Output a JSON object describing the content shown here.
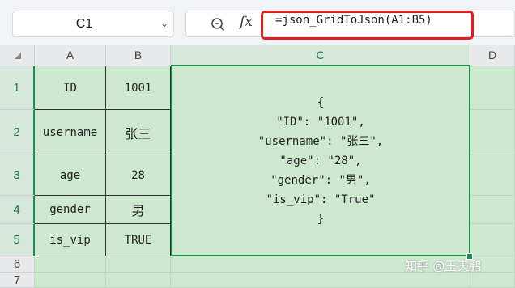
{
  "namebox": {
    "value": "C1",
    "dropdown_icon": "chevron-down-icon"
  },
  "formula_bar": {
    "fx_label": "fx",
    "formula": "=json_GridToJson(A1:B5)"
  },
  "columns": [
    "A",
    "B",
    "C",
    "D"
  ],
  "rows": [
    "1",
    "2",
    "3",
    "4",
    "5",
    "6",
    "7"
  ],
  "table": [
    [
      "ID",
      "1001"
    ],
    [
      "username",
      "张三"
    ],
    [
      "age",
      "28"
    ],
    [
      "gender",
      "男"
    ],
    [
      "is_vip",
      "TRUE"
    ]
  ],
  "json_output": [
    "{",
    "\"ID\": \"1001\",",
    "\"username\": \"张三\",",
    "\"age\": \"28\",",
    "\"gender\": \"男\",",
    "\"is_vip\": \"True\"",
    "}"
  ],
  "watermark": "知乎 @王天鹏",
  "colors": {
    "highlight": "#1e8a4c",
    "cell_fill": "#cde8cf",
    "red_outline": "#e02020"
  }
}
